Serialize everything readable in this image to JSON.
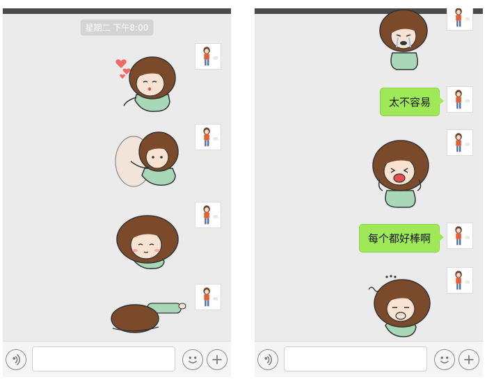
{
  "left_screen": {
    "timestamp": "星期二 下午8:00",
    "stickers": [
      "hearts-hug-sticker",
      "hug-friend-sticker",
      "smile-sticker",
      "lying-down-sticker"
    ]
  },
  "right_screen": {
    "messages": [
      {
        "text": "太不容易"
      },
      {
        "text": "每个都好棒啊"
      }
    ],
    "stickers": [
      "crying-sticker",
      "screaming-sticker",
      "covering-mouth-sticker"
    ]
  },
  "input_bar": {
    "placeholder": "",
    "value": ""
  },
  "icons": {
    "voice": "voice-icon",
    "emoji": "emoji-icon",
    "plus": "plus-icon"
  },
  "colors": {
    "chat_background": "#ebebeb",
    "sent_bubble": "#9fe857",
    "hair": "#7a4a2a",
    "shirt": "#a8d8b8"
  }
}
